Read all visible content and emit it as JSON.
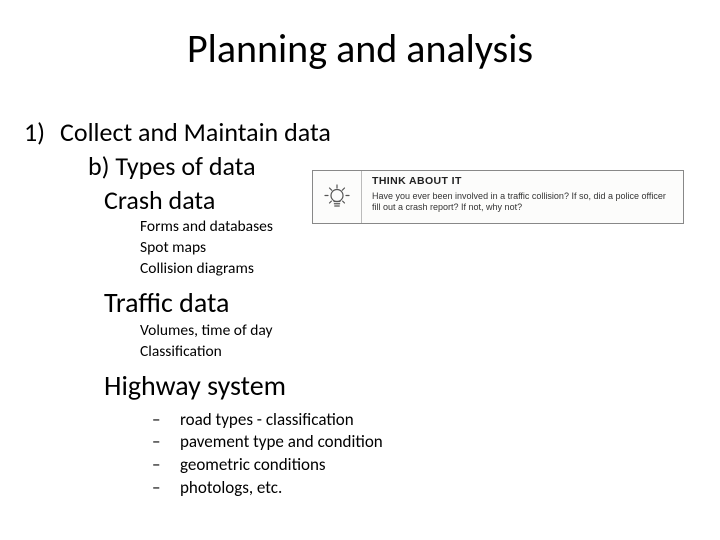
{
  "title": "Planning and analysis",
  "outline": {
    "item1_num": "1)",
    "item1_text": "Collect and Maintain data",
    "b_label": "b) Types of data",
    "crash_heading": "Crash data",
    "crash_sub1": "Forms and databases",
    "crash_sub2": "Spot maps",
    "crash_sub3": "Collision diagrams",
    "traffic_heading": "Traffic data",
    "traffic_sub1": "Volumes, time of day",
    "traffic_sub2": "Classification",
    "highway_heading": "Highway system",
    "hw_dash": "–",
    "hw1": "road types -  classification",
    "hw2": "pavement type and condition",
    "hw3": "geometric conditions",
    "hw4": "photologs, etc."
  },
  "callout": {
    "title": "THINK ABOUT IT",
    "body": "Have you ever been involved in a traffic collision? If so, did a police officer fill out a crash report? If not, why not?",
    "icon": "lightbulb-icon"
  }
}
